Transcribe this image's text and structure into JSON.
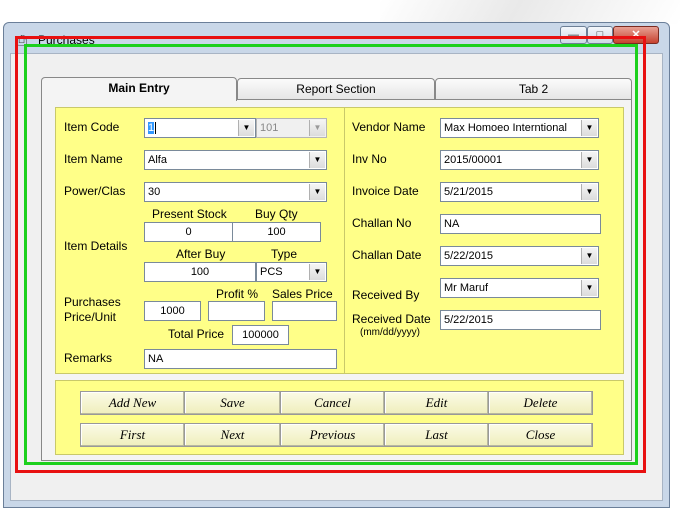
{
  "window": {
    "title": "Purchases",
    "icon": "printer-icon"
  },
  "tabs": [
    {
      "label": "Main Entry",
      "active": true
    },
    {
      "label": "Report Section",
      "active": false
    },
    {
      "label": "Tab 2",
      "active": false
    }
  ],
  "left": {
    "item_code": {
      "label": "Item Code",
      "value": "1",
      "code": "101"
    },
    "item_name": {
      "label": "Item Name",
      "value": "Alfa"
    },
    "power_clas": {
      "label": "Power/Clas",
      "value": "30"
    },
    "item_details": {
      "label": "Item Details",
      "present_stock_label": "Present Stock",
      "present_stock": "0",
      "buy_qty_label": "Buy Qty",
      "buy_qty": "100",
      "after_buy_label": "After Buy",
      "after_buy": "100",
      "type_label": "Type",
      "type": "PCS"
    },
    "purchase_price": {
      "label_line1": "Purchases",
      "label_line2": "Price/Unit",
      "value": "1000",
      "profit_label": "Profit %",
      "profit": "",
      "sales_price_label": "Sales Price",
      "sales_price": ""
    },
    "total_price": {
      "label": "Total Price",
      "value": "100000"
    },
    "remarks": {
      "label": "Remarks",
      "value": "NA"
    }
  },
  "right": {
    "vendor_name": {
      "label": "Vendor Name",
      "value": "Max Homoeo Interntional"
    },
    "inv_no": {
      "label": "Inv No",
      "value": "2015/00001"
    },
    "invoice_date": {
      "label": "Invoice Date",
      "value": "5/21/2015"
    },
    "challan_no": {
      "label": "Challan No",
      "value": "NA"
    },
    "challan_date": {
      "label": "Challan Date",
      "value": "5/22/2015"
    },
    "received_by": {
      "label": "Received By",
      "value": "Mr Maruf"
    },
    "received_date": {
      "label": "Received Date",
      "hint": "(mm/dd/yyyy)",
      "value": "5/22/2015"
    }
  },
  "buttons": {
    "add_new": "Add New",
    "save": "Save",
    "cancel": "Cancel",
    "edit": "Edit",
    "delete": "Delete",
    "first": "First",
    "next": "Next",
    "previous": "Previous",
    "last": "Last",
    "close": "Close"
  },
  "colors": {
    "panel": "#ffff88",
    "outer_border": "#e81010",
    "inner_border": "#1cd01c"
  }
}
